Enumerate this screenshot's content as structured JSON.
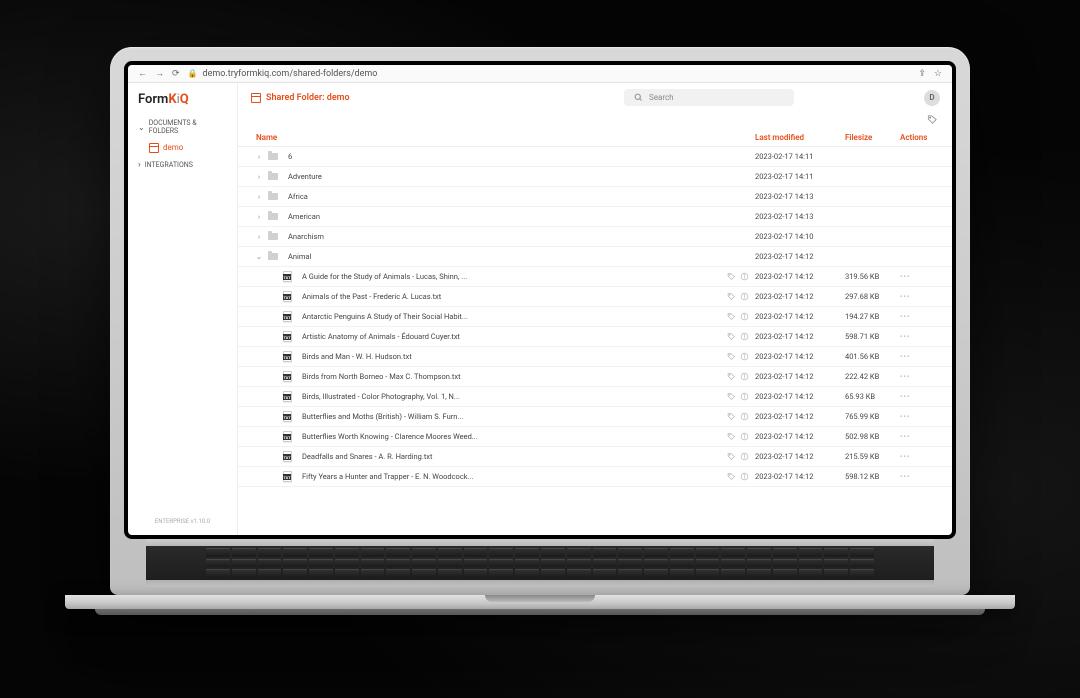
{
  "browser": {
    "url": "demo.tryformkiq.com/shared-folders/demo"
  },
  "brand": {
    "part1": "Form",
    "part2": "K",
    "part3": "i",
    "part4": "Q"
  },
  "sidebar": {
    "section_docs": "DOCUMENTS & FOLDERS",
    "item_demo": "demo",
    "section_integrations": "INTEGRATIONS",
    "footer": "ENTERPRISE v1.10.0"
  },
  "header": {
    "title": "Shared Folder: demo",
    "search_placeholder": "Search",
    "avatar_initial": "D"
  },
  "columns": {
    "name": "Name",
    "modified": "Last modified",
    "size": "Filesize",
    "actions": "Actions"
  },
  "folders": [
    {
      "name": "6",
      "modified": "2023-02-17 14:11"
    },
    {
      "name": "Adventure",
      "modified": "2023-02-17 14:11"
    },
    {
      "name": "Africa",
      "modified": "2023-02-17 14:13"
    },
    {
      "name": "American",
      "modified": "2023-02-17 14:13"
    },
    {
      "name": "Anarchism",
      "modified": "2023-02-17 14:10"
    }
  ],
  "open_folder": {
    "name": "Animal",
    "modified": "2023-02-17 14:12"
  },
  "files": [
    {
      "name": "A Guide for the Study of Animals - Lucas, Shinn, ...",
      "modified": "2023-02-17 14:12",
      "size": "319.56 KB"
    },
    {
      "name": "Animals of the Past - Frederic A. Lucas.txt",
      "modified": "2023-02-17 14:12",
      "size": "297.68 KB"
    },
    {
      "name": "Antarctic Penguins A Study of Their Social Habit...",
      "modified": "2023-02-17 14:12",
      "size": "194.27 KB"
    },
    {
      "name": "Artistic Anatomy of Animals - Édouard Cuyer.txt",
      "modified": "2023-02-17 14:12",
      "size": "598.71 KB"
    },
    {
      "name": "Birds and Man - W. H. Hudson.txt",
      "modified": "2023-02-17 14:12",
      "size": "401.56 KB"
    },
    {
      "name": "Birds from North Borneo - Max C. Thompson.txt",
      "modified": "2023-02-17 14:12",
      "size": "222.42 KB"
    },
    {
      "name": "Birds, Illustrated - Color Photography, Vol. 1, N...",
      "modified": "2023-02-17 14:12",
      "size": "65.93 KB"
    },
    {
      "name": "Butterflies and Moths (British) - William S. Furn...",
      "modified": "2023-02-17 14:12",
      "size": "765.99 KB"
    },
    {
      "name": "Butterflies Worth Knowing - Clarence Moores Weed...",
      "modified": "2023-02-17 14:12",
      "size": "502.98 KB"
    },
    {
      "name": "Deadfalls and Snares - A. R. Harding.txt",
      "modified": "2023-02-17 14:12",
      "size": "215.59 KB"
    },
    {
      "name": "Fifty Years a Hunter and Trapper - E. N. Woodcock...",
      "modified": "2023-02-17 14:12",
      "size": "598.12 KB"
    }
  ]
}
